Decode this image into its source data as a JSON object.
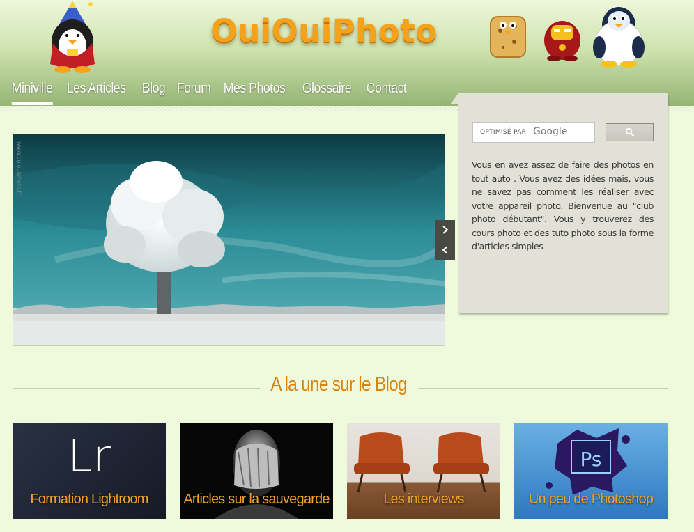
{
  "site": {
    "logo_text": "OuiOuiPhoto"
  },
  "nav": {
    "items": [
      {
        "label": "Miniville",
        "active": true
      },
      {
        "label": "Les Articles",
        "active": false
      },
      {
        "label": "Blog",
        "active": false
      },
      {
        "label": "Forum",
        "active": false
      },
      {
        "label": "Mes Photos",
        "active": false
      },
      {
        "label": "Glossaire",
        "active": false
      },
      {
        "label": "Contact",
        "active": false
      }
    ]
  },
  "slider": {
    "watermark": "www.ouiouiphoto.fr",
    "next_icon": "chevron-right",
    "prev_icon": "chevron-left"
  },
  "search": {
    "label": "OPTIMISÉ PAR",
    "brand": "Google",
    "button_icon": "search-icon"
  },
  "sidebar": {
    "text": "Vous en avez assez de faire des photos en tout auto . Vous avez des idées mais, vous ne savez pas comment les réaliser avec votre appareil photo. Bienvenue au \"club photo débutant\". Vous y trouverez des cours photo et des tuto photo sous la forme d'articles simples"
  },
  "blog": {
    "title": "A la une sur le Blog",
    "cards": [
      {
        "label": "Formation Lightroom",
        "badge": "Lr"
      },
      {
        "label": "Articles sur la sauvegarde"
      },
      {
        "label": "Les interviews"
      },
      {
        "label": "Un peu de Photoshop",
        "badge": "Ps"
      }
    ]
  },
  "colors": {
    "accent": "#f4a21c",
    "blog_title": "#d88412",
    "page_bg": "#eefadb",
    "sidebar_bg": "#e1e1d7"
  }
}
